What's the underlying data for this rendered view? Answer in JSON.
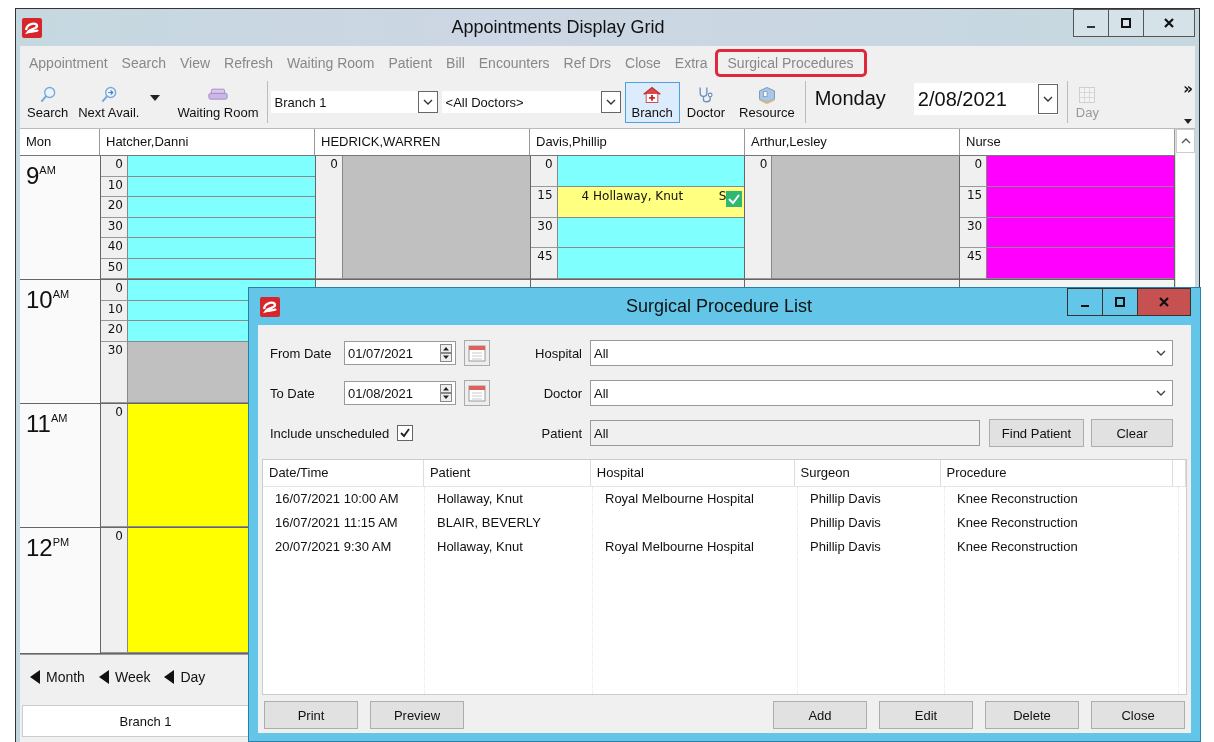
{
  "window": {
    "title": "Appointments Display Grid"
  },
  "menu": [
    {
      "label": "Appointment",
      "highlighted": false
    },
    {
      "label": "Search",
      "highlighted": false
    },
    {
      "label": "View",
      "highlighted": false
    },
    {
      "label": "Refresh",
      "highlighted": false
    },
    {
      "label": "Waiting Room",
      "highlighted": false
    },
    {
      "label": "Patient",
      "highlighted": false
    },
    {
      "label": "Bill",
      "highlighted": false
    },
    {
      "label": "Encounters",
      "highlighted": false
    },
    {
      "label": "Ref Drs",
      "highlighted": false
    },
    {
      "label": "Close",
      "highlighted": false
    },
    {
      "label": "Extra",
      "highlighted": false
    },
    {
      "label": "Surgical Procedures",
      "highlighted": true
    }
  ],
  "toolbar": {
    "search": "Search",
    "next_avail": "Next Avail.",
    "waiting_room": "Waiting Room",
    "branch_select": "Branch 1",
    "doctor_select": "<All Doctors>",
    "view_buttons": [
      {
        "label": "Branch",
        "kind": "branch",
        "selected": true
      },
      {
        "label": "Doctor",
        "kind": "doctor",
        "selected": false
      },
      {
        "label": "Resource",
        "kind": "resource",
        "selected": false
      }
    ],
    "weekday": "Monday",
    "date": "2/08/2021",
    "day_button": {
      "label": "Day",
      "disabled": true
    },
    "overflow": "»"
  },
  "grid": {
    "corner": "Mon",
    "hours": [
      {
        "hour": "9",
        "period": "AM"
      },
      {
        "hour": "10",
        "period": "AM"
      },
      {
        "hour": "11",
        "period": "AM"
      },
      {
        "hour": "12",
        "period": "PM"
      }
    ],
    "columns": [
      {
        "name": "Hatcher,Danni",
        "hours": [
          {
            "slots": [
              {
                "minute": "0",
                "color": "#80ffff"
              },
              {
                "minute": "10",
                "color": "#80ffff"
              },
              {
                "minute": "20",
                "color": "#80ffff"
              },
              {
                "minute": "30",
                "color": "#80ffff"
              },
              {
                "minute": "40",
                "color": "#80ffff"
              },
              {
                "minute": "50",
                "color": "#80ffff"
              }
            ]
          },
          {
            "slots": [
              {
                "minute": "0",
                "color": "#80ffff"
              },
              {
                "minute": "10",
                "color": "#80ffff"
              },
              {
                "minute": "20",
                "color": "#80ffff"
              },
              {
                "minute": "30",
                "color": "#c0c0c0"
              }
            ]
          },
          {
            "slots": [
              {
                "minute": "0",
                "color": "#ffff00"
              }
            ]
          },
          {
            "slots": [
              {
                "minute": "0",
                "color": "#ffff00"
              }
            ]
          }
        ]
      },
      {
        "name": "HEDRICK,WARREN",
        "hours": [
          {
            "slots": [
              {
                "minute": "0",
                "color": "#c0c0c0"
              }
            ]
          }
        ]
      },
      {
        "name": "Davis,Phillip",
        "hours": [
          {
            "slots": [
              {
                "minute": "0",
                "color": "#80ffff"
              },
              {
                "minute": "15",
                "color": "#ffff80",
                "appointment": "4 Hollaway, Knut",
                "status": "S",
                "confirmed": true
              },
              {
                "minute": "30",
                "color": "#80ffff"
              },
              {
                "minute": "45",
                "color": "#80ffff"
              }
            ]
          }
        ]
      },
      {
        "name": "Arthur,Lesley",
        "hours": [
          {
            "slots": [
              {
                "minute": "0",
                "color": "#c0c0c0"
              }
            ]
          }
        ]
      },
      {
        "name": "Nurse",
        "hours": [
          {
            "slots": [
              {
                "minute": "0",
                "color": "#ff00ff"
              },
              {
                "minute": "15",
                "color": "#ff00ff"
              },
              {
                "minute": "30",
                "color": "#ff00ff"
              },
              {
                "minute": "45",
                "color": "#ff00ff"
              }
            ]
          }
        ]
      }
    ]
  },
  "nav": [
    "Month",
    "Week",
    "Day"
  ],
  "tab": "Branch 1",
  "dialog": {
    "title": "Surgical Procedure List",
    "from_date": {
      "label": "From Date",
      "value": "01/07/2021"
    },
    "to_date": {
      "label": "To Date",
      "value": "01/08/2021"
    },
    "include_unscheduled": {
      "label": "Include unscheduled",
      "checked": true
    },
    "hospital": {
      "label": "Hospital",
      "value": "All"
    },
    "doctor": {
      "label": "Doctor",
      "value": "All"
    },
    "patient": {
      "label": "Patient",
      "value": "All"
    },
    "find_patient": "Find Patient",
    "clear": "Clear",
    "table": {
      "columns": [
        "Date/Time",
        "Patient",
        "Hospital",
        "Surgeon",
        "Procedure"
      ],
      "rows": [
        {
          "date_time": "16/07/2021 10:00 AM",
          "patient": "Hollaway, Knut",
          "hospital": "Royal Melbourne Hospital",
          "surgeon": "Phillip Davis",
          "procedure": "Knee Reconstruction"
        },
        {
          "date_time": "16/07/2021 11:15 AM",
          "patient": "BLAIR, BEVERLY",
          "surgeon": "Phillip Davis",
          "procedure": "Knee Reconstruction"
        },
        {
          "date_time": "20/07/2021 9:30 AM",
          "patient": "Hollaway, Knut",
          "hospital": "Royal Melbourne Hospital",
          "surgeon": "Phillip Davis",
          "procedure": "Knee Reconstruction"
        }
      ]
    },
    "buttons_left": [
      "Print",
      "Preview"
    ],
    "buttons_right": [
      "Add",
      "Edit",
      "Delete",
      "Close"
    ]
  }
}
